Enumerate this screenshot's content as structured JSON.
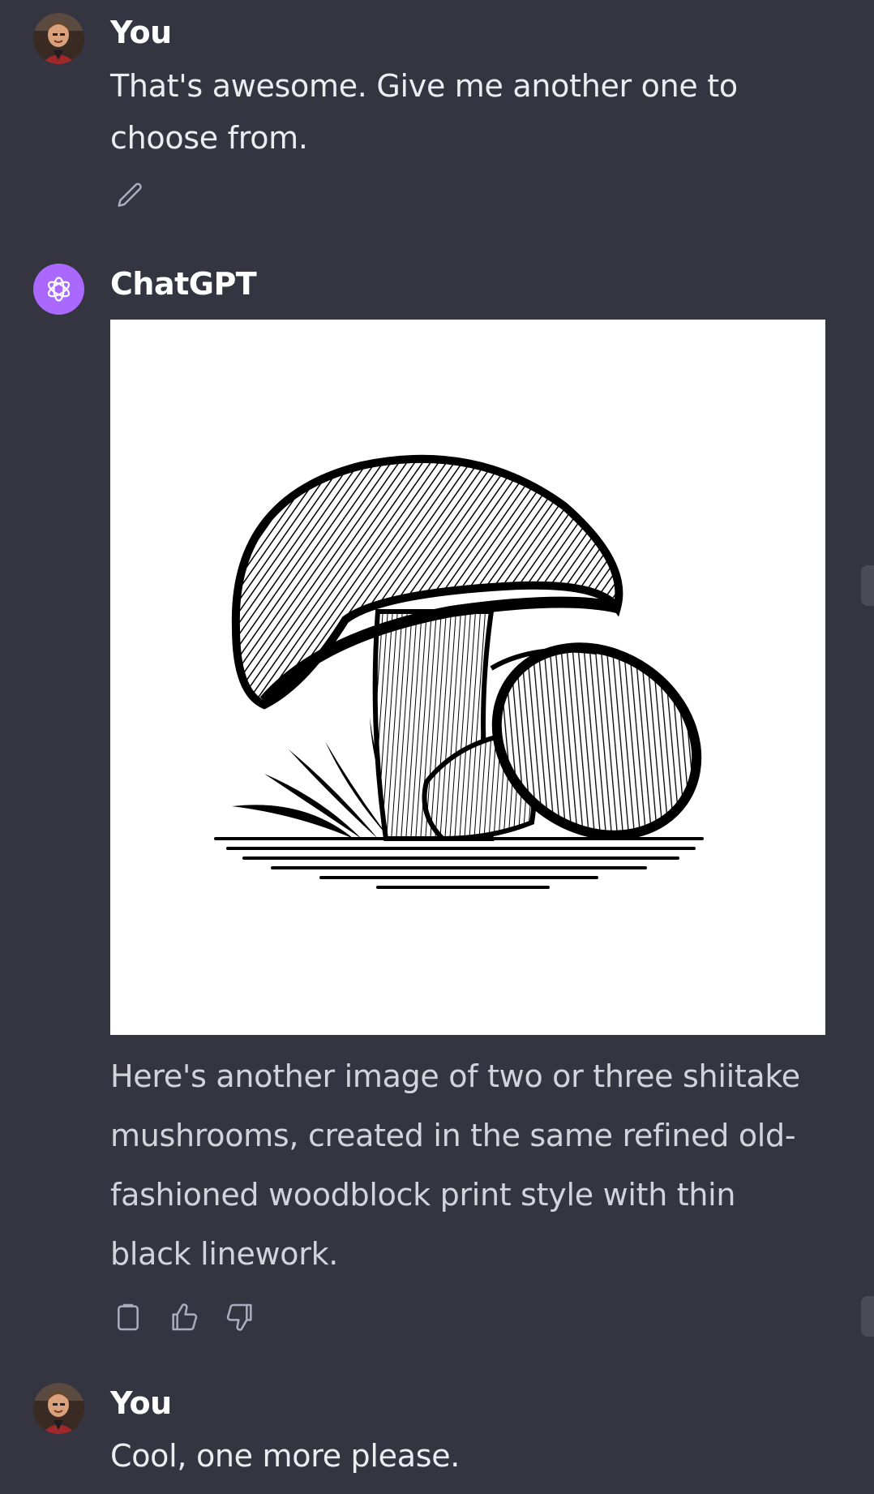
{
  "conversation": {
    "messages": [
      {
        "author": "You",
        "text": "That's awesome.  Give me another one to choose from.",
        "actions": {
          "edit_icon": "pencil-icon"
        }
      },
      {
        "author": "ChatGPT",
        "image": {
          "description_icon": "mushroom-woodblock-illustration"
        },
        "text": "Here's another image of two or three shiitake mushrooms, created in the same refined old-fashioned woodblock print style with thin black linework.",
        "actions": {
          "copy_icon": "clipboard-icon",
          "like_icon": "thumbs-up-icon",
          "dislike_icon": "thumbs-down-icon"
        }
      },
      {
        "author": "You",
        "text": "Cool, one more please."
      }
    ]
  },
  "colors": {
    "background": "#343541",
    "assistant_avatar": "#ab68ff",
    "text_primary": "#ececf1",
    "text_secondary": "#d1d5db",
    "icon": "#acacbe"
  }
}
